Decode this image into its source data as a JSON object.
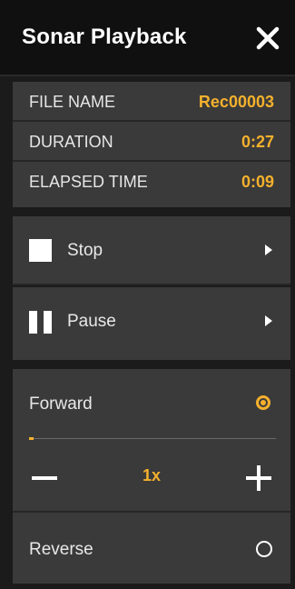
{
  "header": {
    "title": "Sonar Playback"
  },
  "info": [
    {
      "label": "FILE NAME",
      "value": "Rec00003"
    },
    {
      "label": "DURATION",
      "value": "0:27"
    },
    {
      "label": "ELAPSED TIME",
      "value": "0:09"
    }
  ],
  "controls": {
    "stop_label": "Stop",
    "pause_label": "Pause"
  },
  "direction": {
    "forward_label": "Forward",
    "forward_selected": true,
    "speed_label": "1x",
    "progress": 0.02,
    "reverse_label": "Reverse",
    "reverse_selected": false
  },
  "colors": {
    "accent": "#f5b12d",
    "panel": "#3a3a3a",
    "background": "#1b1b1b"
  }
}
